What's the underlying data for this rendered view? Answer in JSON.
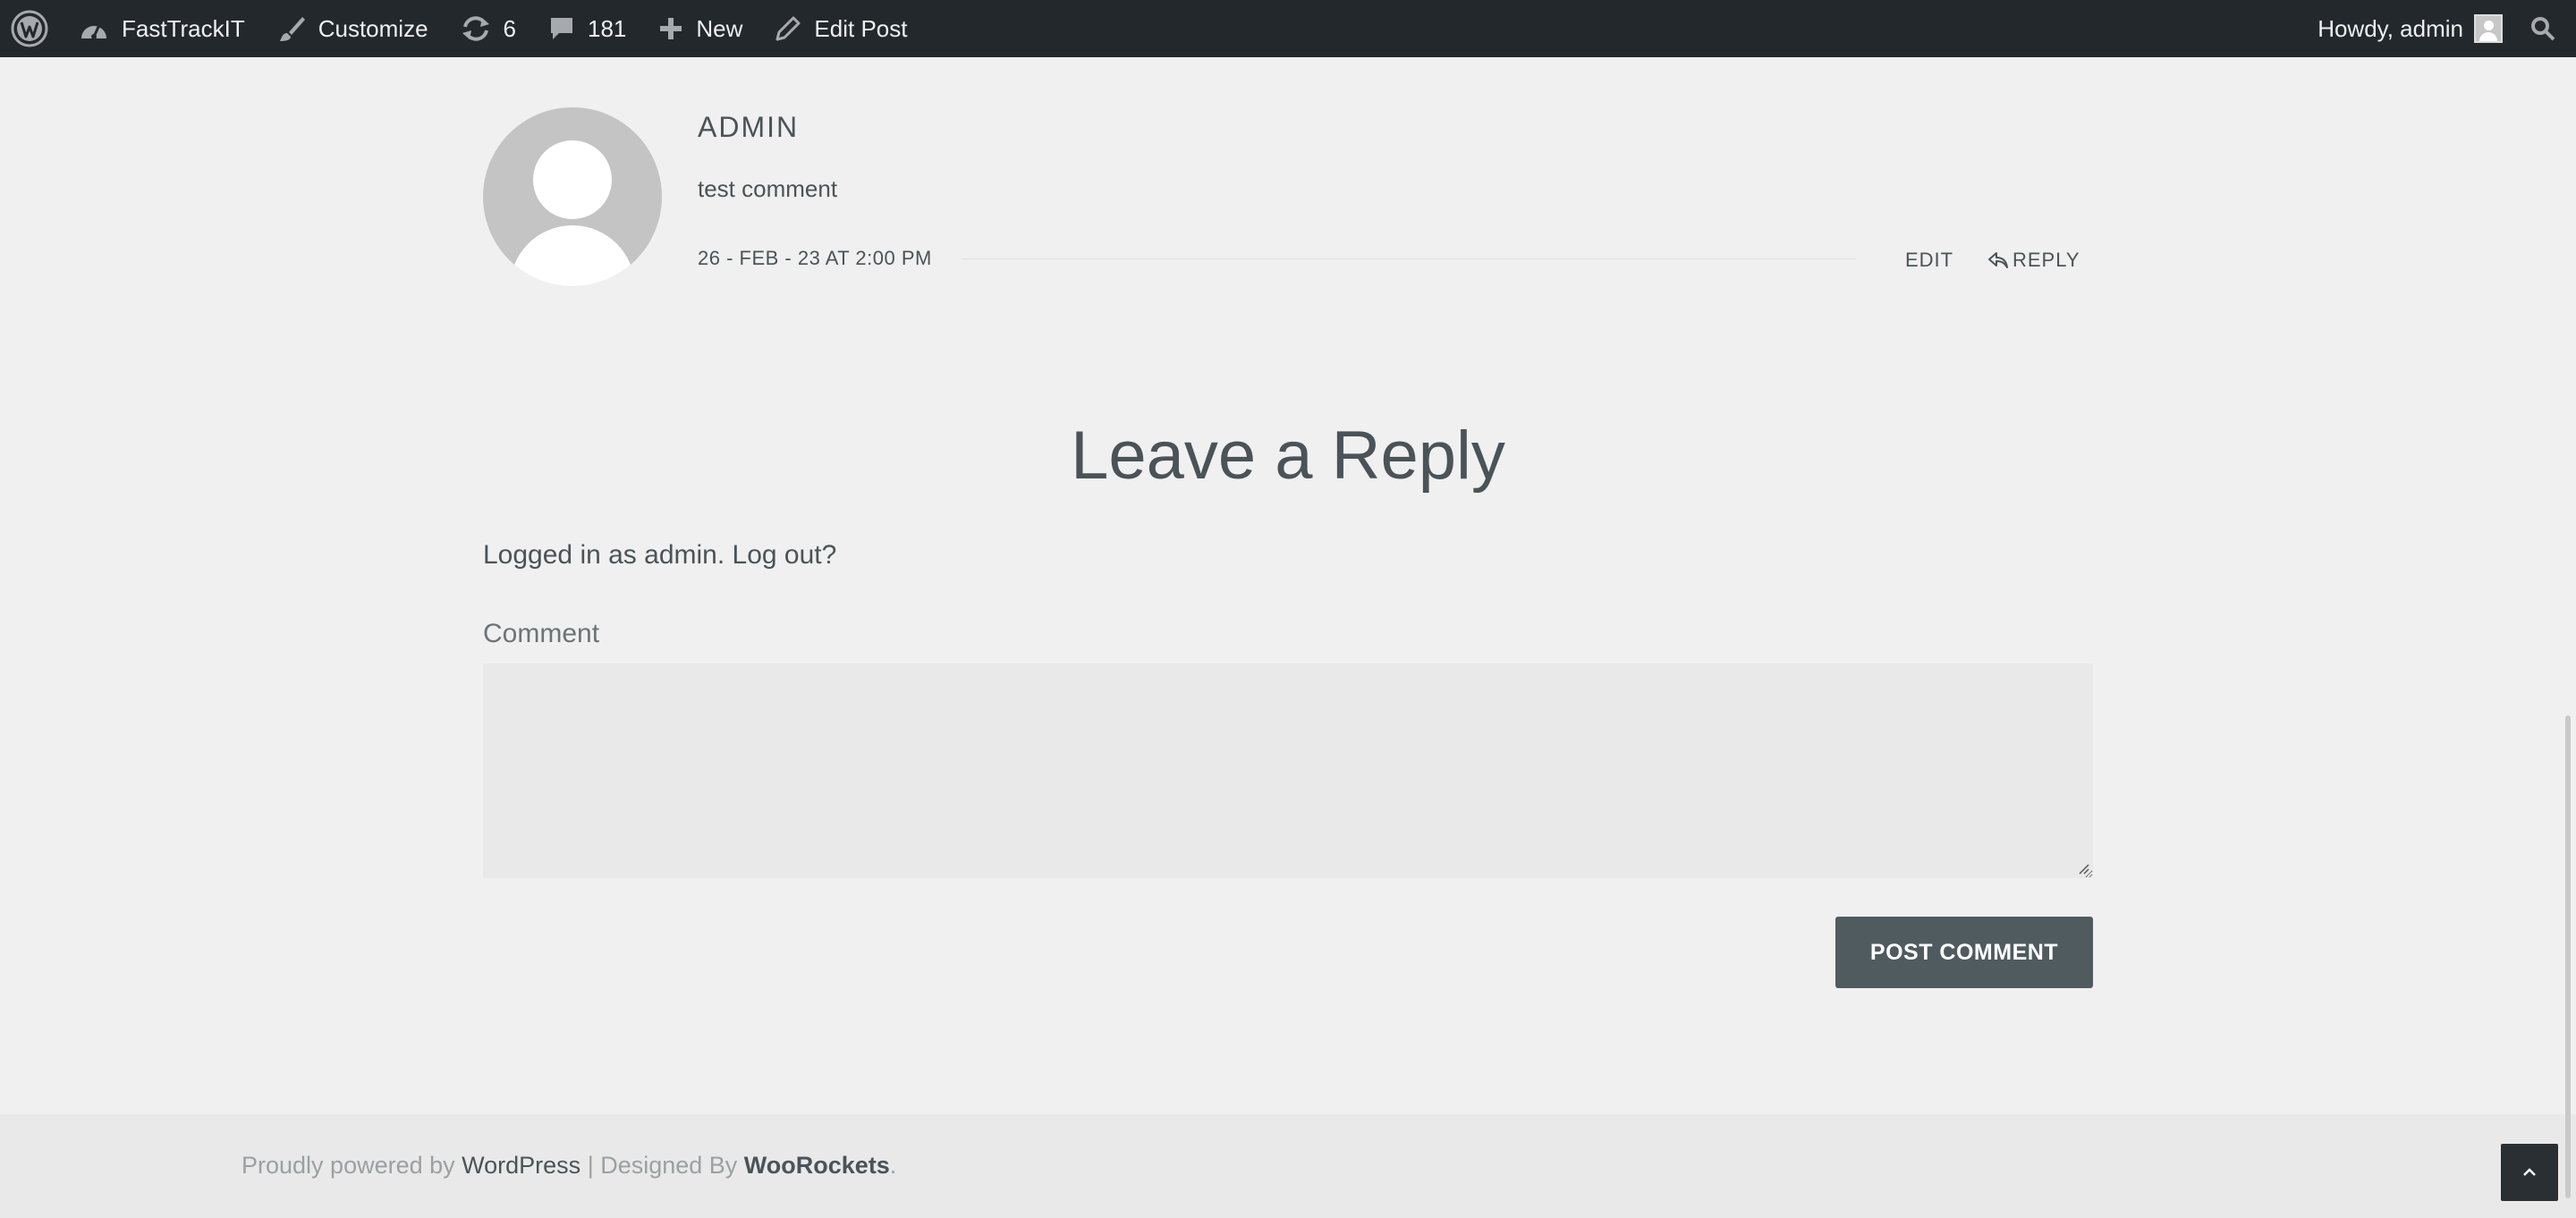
{
  "adminbar": {
    "site_name": "FastTrackIT",
    "customize": "Customize",
    "updates_count": "6",
    "comments_count": "181",
    "new_label": "New",
    "edit_post": "Edit Post",
    "howdy": "Howdy, admin",
    "bg_color": "#23282d"
  },
  "comment": {
    "author": "ADMIN",
    "text": "test comment",
    "date": "26 - FEB - 23 AT 2:00 PM",
    "edit": "EDIT",
    "reply": "REPLY"
  },
  "reply_form": {
    "title": "Leave a Reply",
    "logged_in_text": "Logged in as admin. Log out?",
    "comment_label": "Comment",
    "comment_value": "",
    "submit": "POST COMMENT",
    "submit_color": "#505b5f"
  },
  "footer": {
    "powered_by": "Proudly powered by ",
    "wordpress": "WordPress",
    "separator": " | Designed By ",
    "designer": "WooRockets",
    "period": "."
  }
}
